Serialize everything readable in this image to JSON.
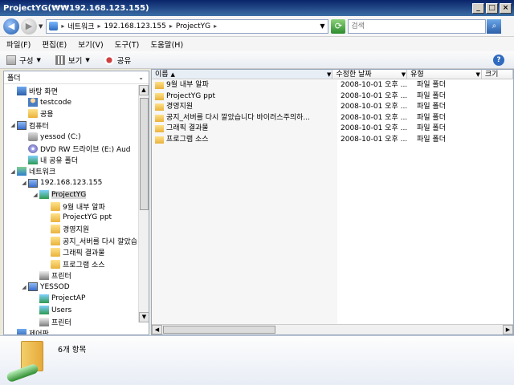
{
  "window": {
    "title": "ProjectYG(₩₩192.168.123.155)",
    "buttons": [
      "_",
      "□",
      "×"
    ]
  },
  "address_bar": {
    "segments": [
      "네트워크",
      "192.168.123.155",
      "ProjectYG"
    ],
    "search_placeholder": "검색"
  },
  "menu": [
    "파일(F)",
    "편집(E)",
    "보기(V)",
    "도구(T)",
    "도움말(H)"
  ],
  "toolbar": {
    "organize": "구성",
    "view": "보기",
    "share": "공유"
  },
  "nav_pane": {
    "header": "폴더",
    "items": [
      {
        "label": "바탕 화면",
        "icon": "desktop-icon"
      },
      {
        "label": "testcode",
        "icon": "user-icon"
      },
      {
        "label": "공용",
        "icon": "folder-icon"
      },
      {
        "label": "컴퓨터",
        "icon": "computer-icon"
      },
      {
        "label": "yessod (C:)",
        "icon": "drive-icon"
      },
      {
        "label": "DVD RW 드라이브 (E:) Aud",
        "icon": "dvd-icon"
      },
      {
        "label": "내 공유 폴더",
        "icon": "shared-folder-icon"
      },
      {
        "label": "네트워크",
        "icon": "network-icon"
      },
      {
        "label": "192.168.123.155",
        "icon": "computer-icon"
      },
      {
        "label": "ProjectYG",
        "icon": "shared-folder-icon",
        "selected": true
      },
      {
        "label": "9월 내부 알파",
        "icon": "folder-icon"
      },
      {
        "label": "ProjectYG ppt",
        "icon": "folder-icon"
      },
      {
        "label": "경영지원",
        "icon": "folder-icon"
      },
      {
        "label": "공지_서버를 다시 깔았습",
        "icon": "folder-icon"
      },
      {
        "label": "그래픽 결과물",
        "icon": "folder-icon"
      },
      {
        "label": "프로그램 소스",
        "icon": "folder-icon"
      },
      {
        "label": "프린터",
        "icon": "printer-icon"
      },
      {
        "label": "YESSOD",
        "icon": "computer-icon"
      },
      {
        "label": "ProjectAP",
        "icon": "shared-folder-icon"
      },
      {
        "label": "Users",
        "icon": "shared-folder-icon"
      },
      {
        "label": "프린터",
        "icon": "printer-icon"
      },
      {
        "label": "제어판",
        "icon": "control-panel-icon"
      }
    ]
  },
  "columns": [
    "이름",
    "수정한 날짜",
    "유형",
    "크기"
  ],
  "files": [
    {
      "name": "9월 내부 알파",
      "date": "2008-10-01 오후 ...",
      "type": "파일 폴더"
    },
    {
      "name": "ProjectYG ppt",
      "date": "2008-10-01 오후 ...",
      "type": "파일 폴더"
    },
    {
      "name": "경영지원",
      "date": "2008-10-01 오후 ...",
      "type": "파일 폴더"
    },
    {
      "name": "공지_서버를 다시 깔았습니다 바이러스주의하...",
      "date": "2008-10-01 오후 ...",
      "type": "파일 폴더"
    },
    {
      "name": "그래픽 결과물",
      "date": "2008-10-01 오후 ...",
      "type": "파일 폴더"
    },
    {
      "name": "프로그램 소스",
      "date": "2008-10-01 오후 ...",
      "type": "파일 폴더"
    }
  ],
  "details": {
    "count": "6개 항목"
  }
}
